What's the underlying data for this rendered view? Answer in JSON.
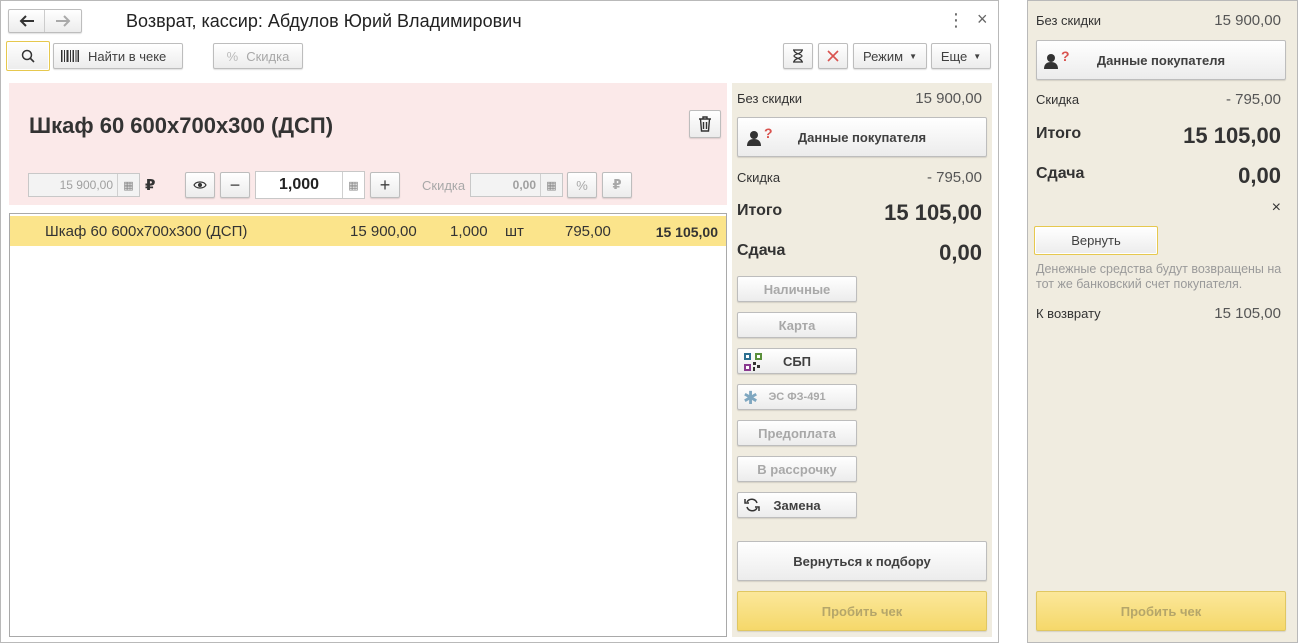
{
  "main": {
    "title": "Возврат, кассир: Абдулов Юрий Владимирович",
    "nav": {
      "back_icon": "arrow-left-icon",
      "forward_icon": "arrow-right-icon"
    },
    "window_controls": {
      "more_icon": "more-vertical-icon",
      "close_icon": "close-icon",
      "close_glyph": "×",
      "more_glyph": "⋮"
    },
    "toolbar": {
      "find_in_receipt": "Найти в чеке",
      "discount": "Скидка",
      "mode": "Режим",
      "more": "Еще"
    },
    "product": {
      "name": "Шкаф 60 600x700x300 (ДСП)",
      "price": "15 900,00",
      "currency": "₽",
      "quantity": "1,000",
      "discount_label": "Скидка",
      "discount_value": "0,00"
    },
    "table": {
      "rows": [
        {
          "name": "Шкаф 60 600x700x300 (ДСП)",
          "price": "15 900,00",
          "qty": "1,000",
          "unit": "шт",
          "discount": "795,00",
          "total": "15 105,00"
        }
      ]
    },
    "summary": {
      "no_discount_label": "Без скидки",
      "no_discount_value": "15 900,00",
      "customer_button": "Данные покупателя",
      "discount_label": "Скидка",
      "discount_value": "- 795,00",
      "total_label": "Итого",
      "total_value": "15 105,00",
      "change_label": "Сдача",
      "change_value": "0,00"
    },
    "payments": {
      "cash": "Наличные",
      "card": "Карта",
      "sbp": "СБП",
      "es": "ЭС ФЗ-491",
      "prepay": "Предоплата",
      "installment": "В рассрочку",
      "replace": "Замена"
    },
    "back_to_selection": "Вернуться к подбору",
    "print_receipt": "Пробить чек"
  },
  "side": {
    "no_discount_label": "Без скидки",
    "no_discount_value": "15 900,00",
    "customer_button": "Данные покупателя",
    "discount_label": "Скидка",
    "discount_value": "- 795,00",
    "total_label": "Итого",
    "total_value": "15 105,00",
    "change_label": "Сдача",
    "change_value": "0,00",
    "close_glyph": "×",
    "return_button": "Вернуть",
    "note": "Денежные средства будут возвращены на тот же банковский счет покупателя.",
    "to_return_label": "К возврату",
    "to_return_value": "15 105,00",
    "print_receipt": "Пробить чек"
  },
  "colors": {
    "accent_yellow": "#f5d86a",
    "selected_row": "#fbe48b",
    "product_bg": "#fbe9e9",
    "panel_bg": "#f0ece0",
    "delete_red": "#d9534f"
  }
}
